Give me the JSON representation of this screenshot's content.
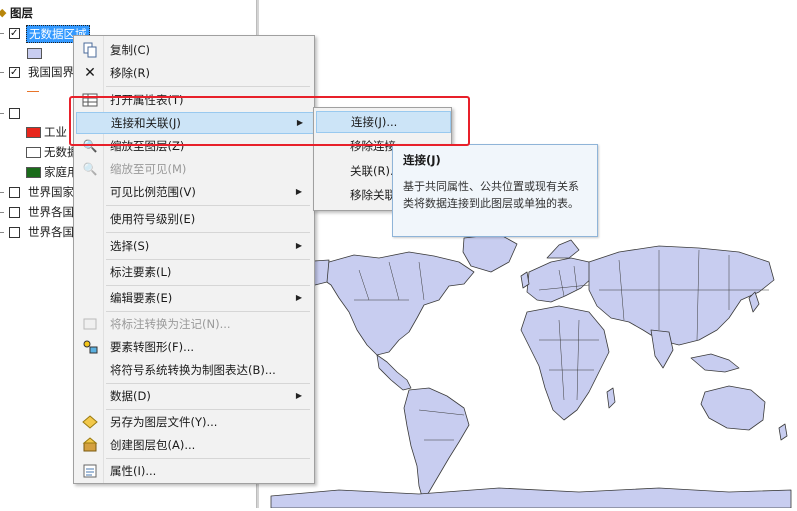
{
  "toc": {
    "header": "图层",
    "layers": [
      {
        "label": "无数据区域",
        "checked": true,
        "selected": true
      },
      {
        "label": "我国国界",
        "checked": true
      },
      {
        "label": "",
        "checked": false
      },
      {
        "label": "工业",
        "color": "#e8261c"
      },
      {
        "label": "无数据",
        "color": "#ffffff"
      },
      {
        "label": "家庭用",
        "color": "#1a6b1a"
      },
      {
        "label": "世界国家",
        "checked": false
      },
      {
        "label": "世界各国",
        "checked": false
      },
      {
        "label": "世界各国",
        "checked": false
      }
    ]
  },
  "context_menu": {
    "items": [
      {
        "label": "复制(C)",
        "icon": "copy-icon"
      },
      {
        "label": "移除(R)",
        "icon": "remove-icon"
      },
      {
        "label": "打开属性表(T)",
        "icon": "table-icon"
      },
      {
        "label": "连接和关联(J)",
        "has_submenu": true,
        "highlighted": true
      },
      {
        "label": "缩放至图层(Z)",
        "icon": "zoom-to-layer-icon"
      },
      {
        "label": "缩放至可见(M)",
        "icon": "zoom-visible-icon",
        "disabled": true
      },
      {
        "label": "可见比例范围(V)",
        "has_submenu": true
      },
      {
        "label": "使用符号级别(E)"
      },
      {
        "label": "选择(S)",
        "has_submenu": true
      },
      {
        "label": "标注要素(L)"
      },
      {
        "label": "编辑要素(E)",
        "has_submenu": true
      },
      {
        "label": "将标注转换为注记(N)...",
        "icon": "convert-labels-icon",
        "disabled": true
      },
      {
        "label": "要素转图形(F)...",
        "icon": "feature-to-graphic-icon"
      },
      {
        "label": "将符号系统转换为制图表达(B)..."
      },
      {
        "label": "数据(D)",
        "has_submenu": true
      },
      {
        "label": "另存为图层文件(Y)...",
        "icon": "layer-file-icon"
      },
      {
        "label": "创建图层包(A)...",
        "icon": "layer-package-icon"
      },
      {
        "label": "属性(I)...",
        "icon": "properties-icon"
      }
    ]
  },
  "submenu": {
    "items": [
      {
        "label": "连接(J)...",
        "highlighted": true
      },
      {
        "label": "移除连接"
      },
      {
        "label": "关联(R)..."
      },
      {
        "label": "移除关联"
      }
    ]
  },
  "tooltip": {
    "title": "连接(J)",
    "description": "基于共同属性、公共位置或现有关系类将数据连接到此图层或单独的表。"
  },
  "colors": {
    "land_fill": "#c8cdf0",
    "land_stroke": "#3a3a3a",
    "highlight": "#cce4f7",
    "annotation_red": "#e8202a"
  }
}
